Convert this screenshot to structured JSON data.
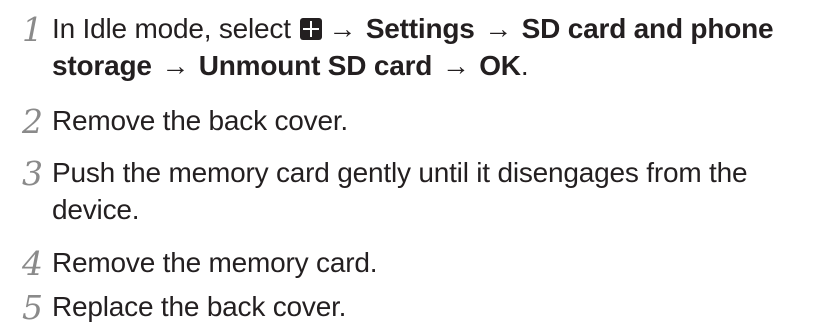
{
  "steps": [
    {
      "number": "1",
      "intro": "In Idle mode, select",
      "icon": "apps-grid-icon",
      "arrow": "→",
      "path_settings": "Settings",
      "path_storage": "SD card and phone storage",
      "path_unmount": "Unmount SD card",
      "path_ok": "OK",
      "period": "."
    },
    {
      "number": "2",
      "text": "Remove the back cover."
    },
    {
      "number": "3",
      "text": "Push the memory card gently until it disengages from the device."
    },
    {
      "number": "4",
      "text": "Remove the memory card."
    },
    {
      "number": "5",
      "text": "Replace the back cover."
    }
  ]
}
